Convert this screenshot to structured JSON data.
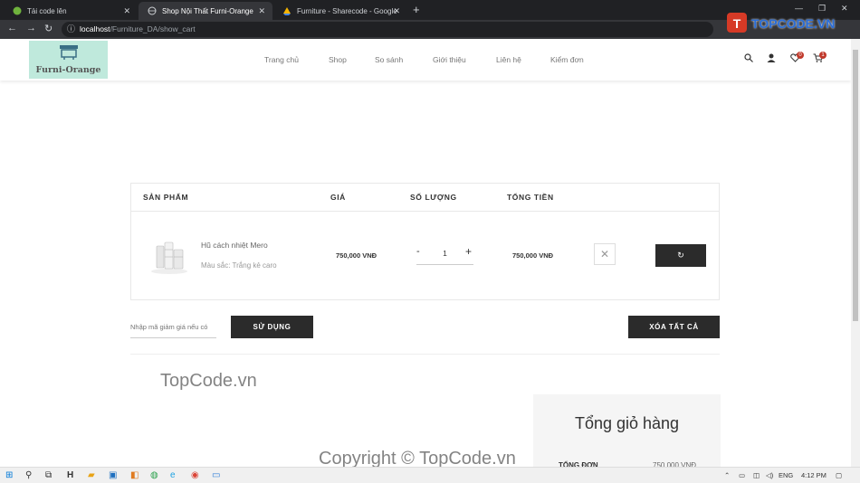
{
  "browser": {
    "tabs": [
      {
        "title": "Tải code lên"
      },
      {
        "title": "Shop Nội Thất Furni-Orange"
      },
      {
        "title": "Furniture - Sharecode - Google Ổ"
      }
    ],
    "url_host": "localhost",
    "url_path": "/Furniture_DA/show_cart"
  },
  "site": {
    "logo_text": "Furni-Orange",
    "nav": [
      "Trang chủ",
      "Shop",
      "So sánh",
      "Giới thiệu",
      "Liên hệ",
      "Kiểm đơn"
    ],
    "wishlist_count": "0",
    "cart_count": "1"
  },
  "cart": {
    "headers": {
      "product": "SẢN PHẨM",
      "price": "GIÁ",
      "qty": "SỐ LƯỢNG",
      "total": "TỔNG TIỀN"
    },
    "item": {
      "name": "Hũ cách nhiệt Mero",
      "color": "Màu sắc: Trắng kẻ caro",
      "price": "750,000 VNĐ",
      "qty": "1",
      "total": "750,000 VNĐ"
    },
    "coupon_placeholder": "Nhập mã giảm giá nếu có",
    "apply_label": "SỬ DỤNG",
    "clear_label": "XÓA TẤT CẢ"
  },
  "summary": {
    "title": "Tổng giỏ hàng",
    "subtotal_label": "TỔNG ĐƠN",
    "subtotal_value": "750,000 VNĐ"
  },
  "watermark": {
    "brand_badge": "TOPCODE.VN",
    "text1": "TopCode.vn",
    "text2": "Copyright © TopCode.vn"
  },
  "taskbar": {
    "lang": "ENG",
    "time": "4:12 PM"
  }
}
